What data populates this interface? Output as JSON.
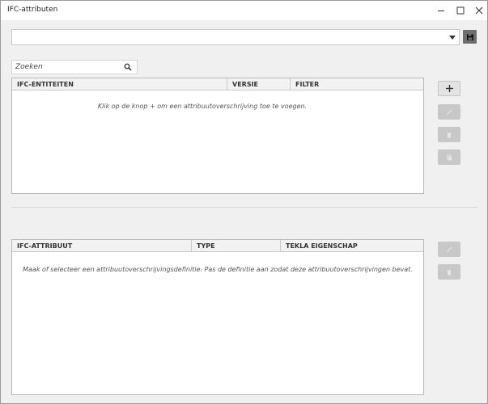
{
  "window": {
    "title": "IFC-attributen",
    "controls": [
      "minimize-icon",
      "maximize-icon",
      "close-icon"
    ]
  },
  "toolbar": {
    "dropdown_value": "",
    "save_icon": "floppy-disk-icon"
  },
  "search": {
    "placeholder": "Zoeken",
    "value": "",
    "icon": "search-icon"
  },
  "entities_table": {
    "columns": [
      "IFC-ENTITEITEN",
      "VERSIE",
      "FILTER"
    ],
    "rows": [],
    "empty_message": "Klik op de knop + om een attribuutoverschrijving toe te voegen."
  },
  "entities_actions": [
    {
      "icon": "plus-icon",
      "enabled": true
    },
    {
      "icon": "pencil-icon",
      "enabled": false
    },
    {
      "icon": "trash-icon",
      "enabled": false
    },
    {
      "icon": "copy-icon",
      "enabled": false
    }
  ],
  "attributes_table": {
    "columns": [
      "IFC-ATTRIBUUT",
      "TYPE",
      "TEKLA EIGENSCHAP"
    ],
    "rows": [],
    "empty_message": "Maak of selecteer een attribuutoverschrijvingsdefinitie. Pas de definitie aan zodat deze attribuutoverschrijvingen bevat."
  },
  "attributes_actions": [
    {
      "icon": "pencil-icon",
      "enabled": false
    },
    {
      "icon": "trash-icon",
      "enabled": false
    }
  ],
  "colors": {
    "disabled_button": "#c8c8c8",
    "save_button": "#6e6e6e",
    "header_bg": "#f2f2f2"
  }
}
